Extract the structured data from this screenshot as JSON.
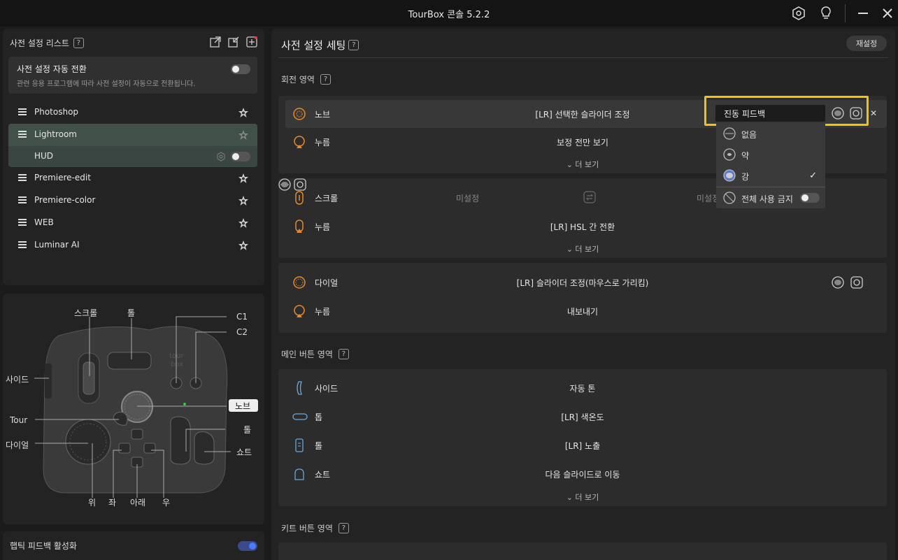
{
  "app": {
    "title": "TourBox 콘솔 5.2.2"
  },
  "left": {
    "preset_list_title": "사전 설정 리스트",
    "auto_switch": {
      "title": "사전 설정 자동 전환",
      "desc": "관련 응용 프로그램에 따라 사전 설정이 자동으로 전환됩니다."
    },
    "presets": [
      {
        "label": "Photoshop"
      },
      {
        "label": "Lightroom"
      },
      {
        "label": "HUD"
      },
      {
        "label": "Premiere-edit"
      },
      {
        "label": "Premiere-color"
      },
      {
        "label": "WEB"
      },
      {
        "label": "Luminar AI"
      }
    ],
    "device_labels": {
      "scroll": "스크롤",
      "tall": "톨",
      "c1": "C1",
      "c2": "C2",
      "side": "사이드",
      "knob": "노브",
      "tour": "Tour",
      "tall2": "톨",
      "dial": "다이얼",
      "short": "쇼트",
      "up": "위",
      "left": "좌",
      "down": "아래",
      "right": "우"
    },
    "haptic_label": "햅틱 피드백 활성화"
  },
  "right": {
    "title": "사전 설정 세팅",
    "reset": "재설정",
    "rotation_section": "회전 영역",
    "knob_card": {
      "row1": {
        "name": "노브",
        "func": "[LR] 선택한 슬라이더 조정"
      },
      "row2": {
        "name": "누름",
        "func": "보정 전만 보기"
      },
      "more": "더 보기"
    },
    "scroll_card": {
      "row1": {
        "name": "스크롤",
        "left": "미설정",
        "right": "미설정"
      },
      "row2": {
        "name": "누름",
        "func": "[LR] HSL 간 전환"
      },
      "more": "더 보기"
    },
    "dial_card": {
      "row1": {
        "name": "다이얼",
        "func": "[LR] 슬라이더 조정(마우스로 가리킴)"
      },
      "row2": {
        "name": "누름",
        "func": "내보내기"
      }
    },
    "main_section": "메인 버튼 영역",
    "main_card": {
      "rows": [
        {
          "name": "사이드",
          "func": "자동 톤"
        },
        {
          "name": "톱",
          "func": "[LR] 색온도"
        },
        {
          "name": "톨",
          "func": "[LR] 노출"
        },
        {
          "name": "쇼트",
          "func": "다음 슬라이드로 이동"
        }
      ],
      "more": "더 보기"
    },
    "kit_section": "키트 버튼 영역"
  },
  "dropdown": {
    "current": "진동 피드백",
    "options": [
      {
        "label": "없음"
      },
      {
        "label": "약"
      },
      {
        "label": "강",
        "checked": "✓"
      }
    ],
    "disable_all": "전체 사용 금지"
  },
  "colors": {
    "accent_orange": "#e8892b",
    "highlight_yellow": "#f4c20d",
    "toggle_blue": "#4d79ff"
  }
}
